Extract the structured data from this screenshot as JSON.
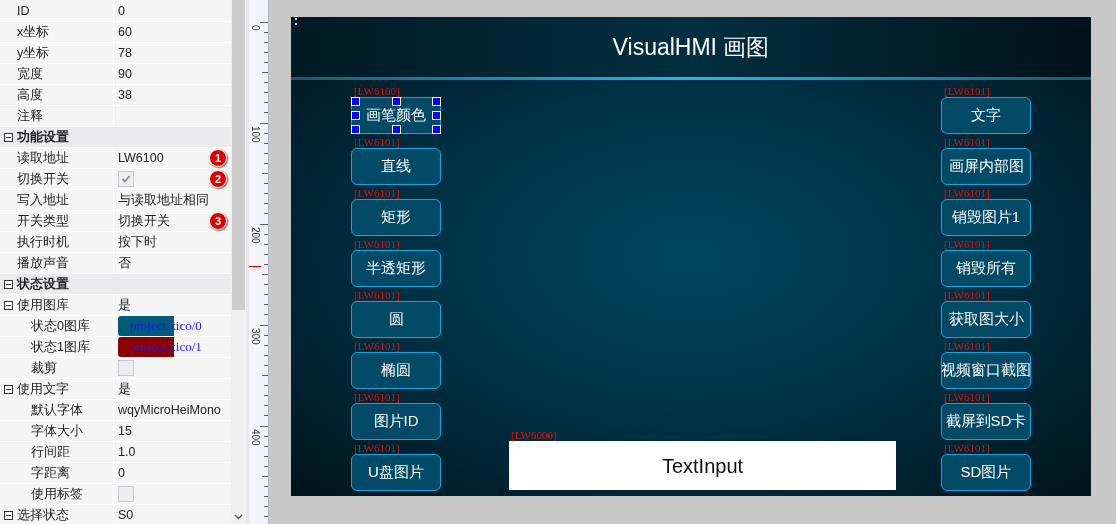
{
  "property_grid": [
    {
      "kind": "row",
      "label": "ID",
      "value": "0"
    },
    {
      "kind": "row",
      "label": "x坐标",
      "value": "60"
    },
    {
      "kind": "row",
      "label": "y坐标",
      "value": "78"
    },
    {
      "kind": "row",
      "label": "宽度",
      "value": "90"
    },
    {
      "kind": "row",
      "label": "高度",
      "value": "38"
    },
    {
      "kind": "row",
      "label": "注释"
    },
    {
      "kind": "section",
      "label": "功能设置",
      "expanded": true,
      "children": [
        {
          "kind": "row",
          "label": "读取地址",
          "value": "LW6100",
          "badge": "1"
        },
        {
          "kind": "check",
          "label": "切换开关",
          "checked": true,
          "badge": "2"
        },
        {
          "kind": "row",
          "label": "写入地址",
          "value": "与读取地址相同"
        },
        {
          "kind": "row",
          "label": "开关类型",
          "value": "切换开关",
          "badge": "3"
        },
        {
          "kind": "row",
          "label": "执行时机",
          "value": "按下时"
        },
        {
          "kind": "row",
          "label": "播放声音",
          "value": "否"
        }
      ]
    },
    {
      "kind": "section",
      "label": "状态设置",
      "expanded": true,
      "children": [
        {
          "kind": "row",
          "label": "使用图库",
          "value": "是",
          "expanded": true,
          "children": [
            {
              "kind": "image",
              "label": "状态0图库",
              "value": "project.xico/0",
              "color": "#005a78"
            },
            {
              "kind": "image",
              "label": "状态1图库",
              "value": "project.xico/1",
              "color": "#8b0000"
            },
            {
              "kind": "check",
              "label": "裁剪",
              "checked": false
            }
          ]
        },
        {
          "kind": "row",
          "label": "使用文字",
          "value": "是",
          "expanded": true,
          "children": [
            {
              "kind": "row",
              "label": "默认字体",
              "value": "wqyMicroHeiMono"
            },
            {
              "kind": "row",
              "label": "字体大小",
              "value": "15"
            },
            {
              "kind": "row",
              "label": "行间距",
              "value": "1.0"
            },
            {
              "kind": "row",
              "label": "字距离",
              "value": "0"
            },
            {
              "kind": "check",
              "label": "使用标签",
              "checked": false
            }
          ]
        },
        {
          "kind": "row",
          "label": "选择状态",
          "value": "S0",
          "expanded": true
        }
      ]
    }
  ],
  "ruler": {
    "labels": [
      "0",
      "100",
      "200",
      "300",
      "400"
    ]
  },
  "hmi": {
    "title": "VisualHMI 画图",
    "left_buttons": [
      {
        "address": "[LW6100]",
        "label": "画笔颜色",
        "selected": true
      },
      {
        "address": "[LW6101]",
        "label": "直线",
        "selected": false
      },
      {
        "address": "[LW6101]",
        "label": "矩形",
        "selected": false
      },
      {
        "address": "[LW6101]",
        "label": "半透矩形",
        "selected": false
      },
      {
        "address": "[LW6101]",
        "label": "圆",
        "selected": false
      },
      {
        "address": "[LW6101]",
        "label": "椭圆",
        "selected": false
      },
      {
        "address": "[LW6101]",
        "label": "图片ID",
        "selected": false
      },
      {
        "address": "[LW6101]",
        "label": "U盘图片",
        "selected": false
      }
    ],
    "right_buttons": [
      {
        "address": "[LW6101]",
        "label": "文字",
        "selected": false
      },
      {
        "address": "[LW6101]",
        "label": "画屏内部图",
        "selected": false
      },
      {
        "address": "[LW6101]",
        "label": "销毁图片1",
        "selected": false
      },
      {
        "address": "[LW6101]",
        "label": "销毁所有",
        "selected": false
      },
      {
        "address": "[LW6101]",
        "label": "获取图大小",
        "selected": false
      },
      {
        "address": "[LW6101]",
        "label": "视频窗口截图",
        "selected": false
      },
      {
        "address": "[LW6101]",
        "label": "截屏到SD卡",
        "selected": false
      },
      {
        "address": "[LW6101]",
        "label": "SD图片",
        "selected": false
      }
    ],
    "text_input": {
      "address": "[LW6000]",
      "value": "TextInput"
    }
  }
}
